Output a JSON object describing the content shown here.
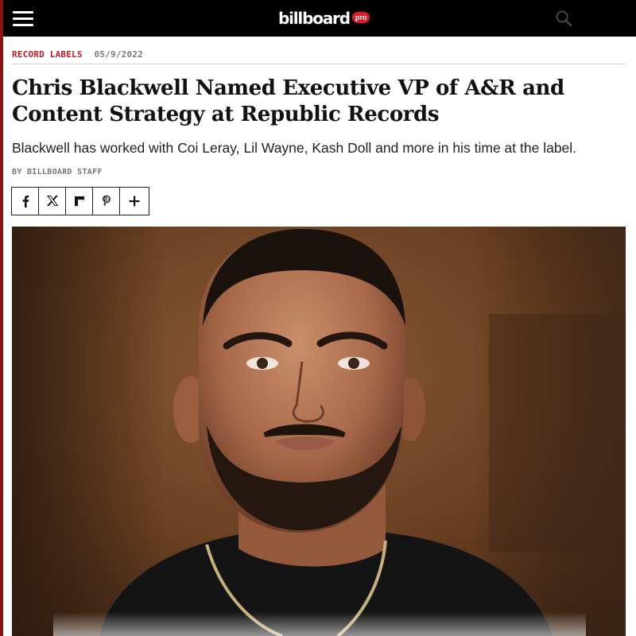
{
  "header": {
    "menu_icon": "hamburger-menu-icon",
    "logo_text": "billboard",
    "logo_badge": "pro",
    "search_icon": "search-icon",
    "background": "#000000",
    "badge_color": "#e21b2c"
  },
  "article": {
    "category": "RECORD LABELS",
    "date": "05/9/2022",
    "headline": "Chris Blackwell Named Executive VP of A&R and Content Strategy at Republic Records",
    "dek": "Blackwell has worked with Coi Leray, Lil Wayne, Kash Doll and more in his time at the label.",
    "byline": "BY BILLBOARD STAFF",
    "category_color": "#c41a28"
  },
  "share": {
    "buttons": [
      {
        "icon": "facebook-icon"
      },
      {
        "icon": "x-twitter-icon"
      },
      {
        "icon": "flipboard-icon"
      },
      {
        "icon": "pinterest-icon"
      },
      {
        "icon": "plus-icon"
      }
    ]
  },
  "photo": {
    "subject": "portrait-photo"
  }
}
